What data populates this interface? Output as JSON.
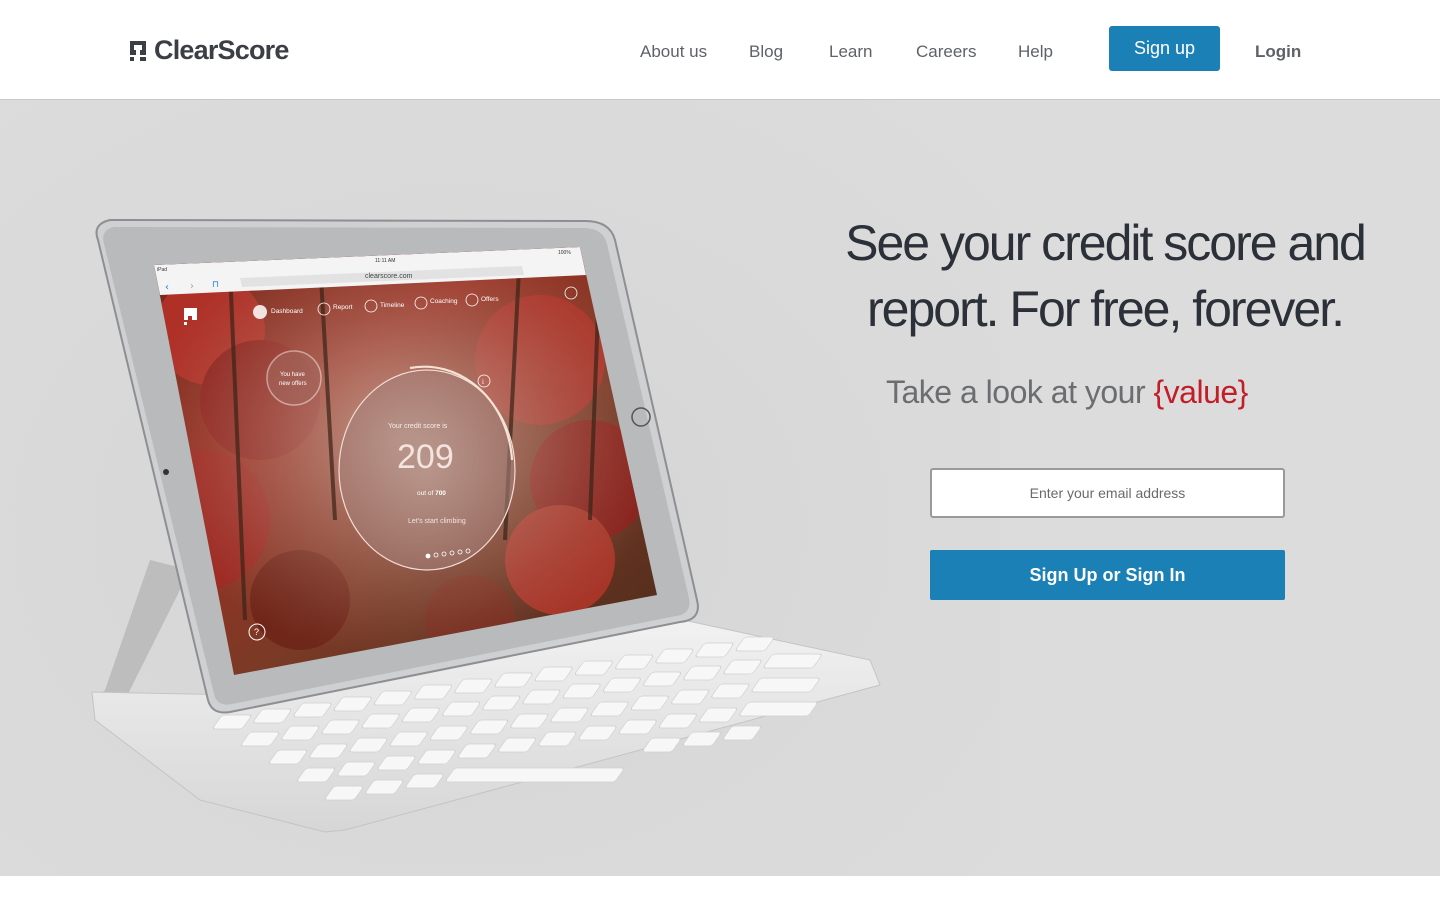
{
  "header": {
    "brand": "ClearScore",
    "nav": [
      {
        "label": "About us"
      },
      {
        "label": "Blog"
      },
      {
        "label": "Learn"
      },
      {
        "label": "Careers"
      },
      {
        "label": "Help"
      }
    ],
    "signup_label": "Sign up",
    "login_label": "Login"
  },
  "hero": {
    "headline_line1": "See your credit score and",
    "headline_line2": "report. For free, forever.",
    "subline_prefix": "Take a look at your ",
    "subline_value": "{value}",
    "email_placeholder": "Enter your email address",
    "cta_label": "Sign Up or Sign In"
  },
  "device_screen": {
    "status_left": "iPad",
    "status_time": "11:11 AM",
    "status_right": "100%",
    "url": "clearscore.com",
    "tabs": [
      "Dashboard",
      "Report",
      "Timeline",
      "Coaching",
      "Offers"
    ],
    "offers_bubble_line1": "You have",
    "offers_bubble_line2": "new offers",
    "score_caption": "Your credit score is",
    "score": "209",
    "score_out_of_prefix": "out of ",
    "score_max": "700",
    "score_tagline": "Let's start climbing"
  },
  "colors": {
    "brand_blue": "#1a80b6",
    "accent_red": "#c31d28",
    "hero_bg": "#dcdcdc"
  }
}
